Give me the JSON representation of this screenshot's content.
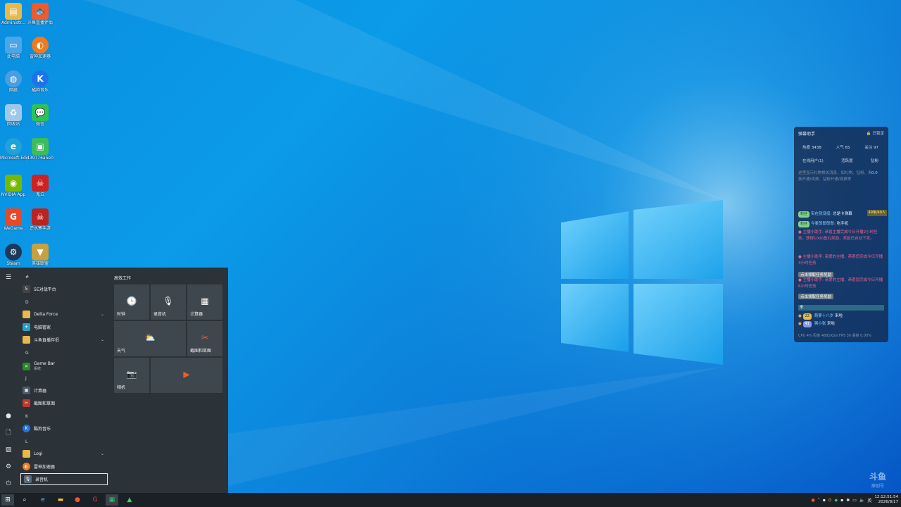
{
  "desktop": {
    "icons": [
      {
        "label": "Administr...",
        "icon": "user-folder-icon",
        "color": "#e8b84a"
      },
      {
        "label": "斗鱼直播伴侣",
        "icon": "douyu-icon",
        "color": "#f25a2a"
      },
      {
        "label": "此电脑",
        "icon": "computer-icon",
        "color": "#4aa6e8"
      },
      {
        "label": "雷神加速器",
        "icon": "leishen-icon",
        "color": "#f07a20"
      },
      {
        "label": "网络",
        "icon": "network-icon",
        "color": "#4a9ee0"
      },
      {
        "label": "酷狗音乐",
        "icon": "kugou-icon",
        "color": "#1d74e8"
      },
      {
        "label": "回收站",
        "icon": "recycle-bin-icon",
        "color": "#9ec8e8"
      },
      {
        "label": "微信",
        "icon": "wechat-icon",
        "color": "#2dc158"
      },
      {
        "label": "Microsoft Edge",
        "icon": "edge-icon",
        "color": "#1fa2d8"
      },
      {
        "label": "439776a5e0f...",
        "icon": "file-icon",
        "color": "#3cbc5c"
      },
      {
        "label": "NVIDIA App",
        "icon": "nvidia-icon",
        "color": "#76b900"
      },
      {
        "label": "鬼泣",
        "icon": "game-icon",
        "color": "#c22"
      },
      {
        "label": "WeGame",
        "icon": "wegame-icon",
        "color": "#e8482a"
      },
      {
        "label": "逆水寒手游",
        "icon": "game-icon-2",
        "color": "#b22"
      },
      {
        "label": "Steam",
        "icon": "steam-icon",
        "color": "#1b3a5a"
      },
      {
        "label": "英雄联盟",
        "icon": "lol-icon",
        "color": "#c8a040"
      }
    ]
  },
  "start_menu": {
    "tiles_header": "高效工作",
    "letters": [
      "#",
      "D",
      "G",
      "J",
      "K",
      "L"
    ],
    "apps": [
      {
        "label": "5E对战平台",
        "icon": "5e-icon",
        "color": "#444"
      },
      {
        "label": "Delta Force",
        "icon": "folder-icon",
        "color": "#e8b84a",
        "chevron": "⌄"
      },
      {
        "label": "电脑管家",
        "icon": "pc-manager-icon",
        "color": "#2aa0c8"
      },
      {
        "label": "斗鱼直播伴侣",
        "icon": "folder-icon",
        "color": "#e8b84a",
        "chevron": "⌄"
      },
      {
        "label": "Game Bar",
        "sub": "系统",
        "icon": "xbox-icon",
        "color": "#2a8a2a"
      },
      {
        "label": "计算器",
        "icon": "calculator-icon",
        "color": "#4a5a6a"
      },
      {
        "label": "截图和草图",
        "icon": "snip-icon",
        "color": "#c2372a"
      },
      {
        "label": "酷狗音乐",
        "icon": "kugou-icon",
        "color": "#1d74e8"
      },
      {
        "label": "Logi",
        "icon": "folder-icon",
        "color": "#e8b84a",
        "chevron": "⌄"
      },
      {
        "label": "雷神加速器",
        "icon": "leishen-icon",
        "color": "#f07a20"
      },
      {
        "label": "录音机",
        "icon": "recorder-icon",
        "color": "#5a6a7a"
      }
    ],
    "tiles": [
      {
        "label": "时钟",
        "icon": "clock-icon",
        "glyph": "🕒"
      },
      {
        "label": "录音机",
        "icon": "recorder-icon",
        "glyph": "🎙"
      },
      {
        "label": "计算器",
        "icon": "calculator-icon",
        "glyph": "▦"
      },
      {
        "label": "天气",
        "icon": "weather-icon",
        "glyph": "⛅"
      },
      {
        "label": "截图和草图",
        "icon": "snip-icon",
        "glyph": "✂"
      },
      {
        "label": "相机",
        "icon": "camera-icon",
        "glyph": "📷"
      },
      {
        "label": "",
        "icon": "media-player-icon",
        "glyph": "▶"
      }
    ]
  },
  "assistant": {
    "title": "弹幕助手",
    "lock_label": "已锁定",
    "stats": [
      "热度 3438",
      "人气 65",
      "关注 97"
    ],
    "tabs": [
      "在线用户(1)",
      "活跃度",
      "钻粉"
    ],
    "info": "这里显示礼物相关消息，如礼物、钻粉、贵族开通/续费、钻粉开通/续费等",
    "info_value": "0.0",
    "chats": [
      {
        "tag": "粉丝",
        "user": "实在就没挺:",
        "text": "总是卡弹幕",
        "count": "49条/49人"
      },
      {
        "tag": "粉丝",
        "user": "今麦郎郎郎郎:",
        "text": "吃手机"
      },
      {
        "user": "主播小助手:",
        "text": "恭喜主播完成今日开播2小时任务，获得1000鱼丸奖励，奖励已自动下发。"
      },
      {
        "user": "主播小助手:",
        "text": "亲爱的主播，恭喜您完成今日开播4小时任务"
      },
      {
        "user": "主播小助手:",
        "text": "亲爱的主播，恭喜您完成今日开播6小时任务"
      }
    ],
    "claim_label": "点击领取任务奖励",
    "enter_header": "来",
    "enters": [
      {
        "level": "22",
        "user": "萌萝十八岁",
        "action": "来啦"
      },
      {
        "level": "41",
        "user": "粥小张",
        "action": "来啦"
      }
    ],
    "footer": "CPU 4%  码率 4681Kb/s  FPS 30  丢帧 0.00%"
  },
  "taskbar": {
    "time": "12:12:51:54",
    "date": "2026/8/17",
    "ime": "英"
  },
  "watermark": {
    "logo": "斗鱼",
    "sub": "原创号"
  }
}
